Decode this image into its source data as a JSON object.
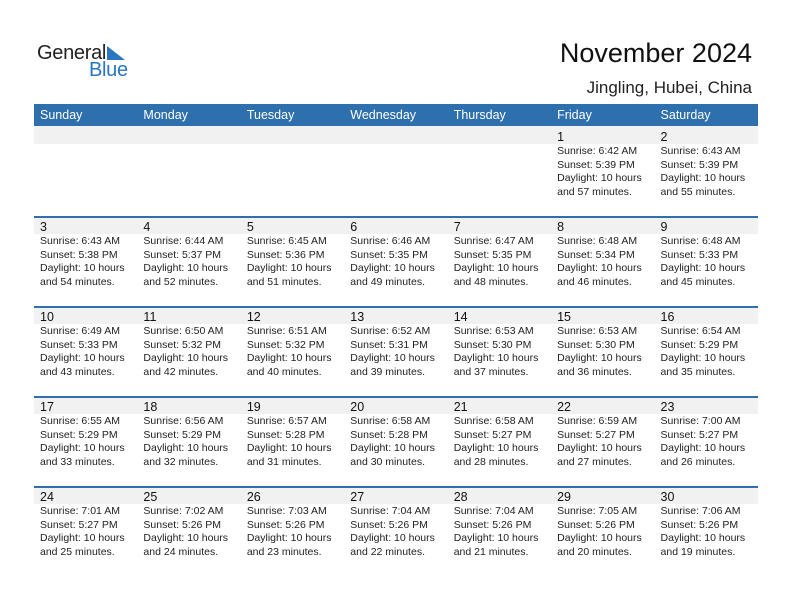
{
  "logo": {
    "line1": "General",
    "line2": "Blue"
  },
  "title": "November 2024",
  "location": "Jingling, Hubei, China",
  "colors": {
    "accent": "#2e6fad",
    "logo_blue": "#2a77c0",
    "band": "#f1f1f1"
  },
  "weekdays": [
    "Sunday",
    "Monday",
    "Tuesday",
    "Wednesday",
    "Thursday",
    "Friday",
    "Saturday"
  ],
  "weeks": [
    [
      {
        "day": "",
        "sunrise": "",
        "sunset": "",
        "daylight1": "",
        "daylight2": ""
      },
      {
        "day": "",
        "sunrise": "",
        "sunset": "",
        "daylight1": "",
        "daylight2": ""
      },
      {
        "day": "",
        "sunrise": "",
        "sunset": "",
        "daylight1": "",
        "daylight2": ""
      },
      {
        "day": "",
        "sunrise": "",
        "sunset": "",
        "daylight1": "",
        "daylight2": ""
      },
      {
        "day": "",
        "sunrise": "",
        "sunset": "",
        "daylight1": "",
        "daylight2": ""
      },
      {
        "day": "1",
        "sunrise": "Sunrise: 6:42 AM",
        "sunset": "Sunset: 5:39 PM",
        "daylight1": "Daylight: 10 hours",
        "daylight2": "and 57 minutes."
      },
      {
        "day": "2",
        "sunrise": "Sunrise: 6:43 AM",
        "sunset": "Sunset: 5:39 PM",
        "daylight1": "Daylight: 10 hours",
        "daylight2": "and 55 minutes."
      }
    ],
    [
      {
        "day": "3",
        "sunrise": "Sunrise: 6:43 AM",
        "sunset": "Sunset: 5:38 PM",
        "daylight1": "Daylight: 10 hours",
        "daylight2": "and 54 minutes."
      },
      {
        "day": "4",
        "sunrise": "Sunrise: 6:44 AM",
        "sunset": "Sunset: 5:37 PM",
        "daylight1": "Daylight: 10 hours",
        "daylight2": "and 52 minutes."
      },
      {
        "day": "5",
        "sunrise": "Sunrise: 6:45 AM",
        "sunset": "Sunset: 5:36 PM",
        "daylight1": "Daylight: 10 hours",
        "daylight2": "and 51 minutes."
      },
      {
        "day": "6",
        "sunrise": "Sunrise: 6:46 AM",
        "sunset": "Sunset: 5:35 PM",
        "daylight1": "Daylight: 10 hours",
        "daylight2": "and 49 minutes."
      },
      {
        "day": "7",
        "sunrise": "Sunrise: 6:47 AM",
        "sunset": "Sunset: 5:35 PM",
        "daylight1": "Daylight: 10 hours",
        "daylight2": "and 48 minutes."
      },
      {
        "day": "8",
        "sunrise": "Sunrise: 6:48 AM",
        "sunset": "Sunset: 5:34 PM",
        "daylight1": "Daylight: 10 hours",
        "daylight2": "and 46 minutes."
      },
      {
        "day": "9",
        "sunrise": "Sunrise: 6:48 AM",
        "sunset": "Sunset: 5:33 PM",
        "daylight1": "Daylight: 10 hours",
        "daylight2": "and 45 minutes."
      }
    ],
    [
      {
        "day": "10",
        "sunrise": "Sunrise: 6:49 AM",
        "sunset": "Sunset: 5:33 PM",
        "daylight1": "Daylight: 10 hours",
        "daylight2": "and 43 minutes."
      },
      {
        "day": "11",
        "sunrise": "Sunrise: 6:50 AM",
        "sunset": "Sunset: 5:32 PM",
        "daylight1": "Daylight: 10 hours",
        "daylight2": "and 42 minutes."
      },
      {
        "day": "12",
        "sunrise": "Sunrise: 6:51 AM",
        "sunset": "Sunset: 5:32 PM",
        "daylight1": "Daylight: 10 hours",
        "daylight2": "and 40 minutes."
      },
      {
        "day": "13",
        "sunrise": "Sunrise: 6:52 AM",
        "sunset": "Sunset: 5:31 PM",
        "daylight1": "Daylight: 10 hours",
        "daylight2": "and 39 minutes."
      },
      {
        "day": "14",
        "sunrise": "Sunrise: 6:53 AM",
        "sunset": "Sunset: 5:30 PM",
        "daylight1": "Daylight: 10 hours",
        "daylight2": "and 37 minutes."
      },
      {
        "day": "15",
        "sunrise": "Sunrise: 6:53 AM",
        "sunset": "Sunset: 5:30 PM",
        "daylight1": "Daylight: 10 hours",
        "daylight2": "and 36 minutes."
      },
      {
        "day": "16",
        "sunrise": "Sunrise: 6:54 AM",
        "sunset": "Sunset: 5:29 PM",
        "daylight1": "Daylight: 10 hours",
        "daylight2": "and 35 minutes."
      }
    ],
    [
      {
        "day": "17",
        "sunrise": "Sunrise: 6:55 AM",
        "sunset": "Sunset: 5:29 PM",
        "daylight1": "Daylight: 10 hours",
        "daylight2": "and 33 minutes."
      },
      {
        "day": "18",
        "sunrise": "Sunrise: 6:56 AM",
        "sunset": "Sunset: 5:29 PM",
        "daylight1": "Daylight: 10 hours",
        "daylight2": "and 32 minutes."
      },
      {
        "day": "19",
        "sunrise": "Sunrise: 6:57 AM",
        "sunset": "Sunset: 5:28 PM",
        "daylight1": "Daylight: 10 hours",
        "daylight2": "and 31 minutes."
      },
      {
        "day": "20",
        "sunrise": "Sunrise: 6:58 AM",
        "sunset": "Sunset: 5:28 PM",
        "daylight1": "Daylight: 10 hours",
        "daylight2": "and 30 minutes."
      },
      {
        "day": "21",
        "sunrise": "Sunrise: 6:58 AM",
        "sunset": "Sunset: 5:27 PM",
        "daylight1": "Daylight: 10 hours",
        "daylight2": "and 28 minutes."
      },
      {
        "day": "22",
        "sunrise": "Sunrise: 6:59 AM",
        "sunset": "Sunset: 5:27 PM",
        "daylight1": "Daylight: 10 hours",
        "daylight2": "and 27 minutes."
      },
      {
        "day": "23",
        "sunrise": "Sunrise: 7:00 AM",
        "sunset": "Sunset: 5:27 PM",
        "daylight1": "Daylight: 10 hours",
        "daylight2": "and 26 minutes."
      }
    ],
    [
      {
        "day": "24",
        "sunrise": "Sunrise: 7:01 AM",
        "sunset": "Sunset: 5:27 PM",
        "daylight1": "Daylight: 10 hours",
        "daylight2": "and 25 minutes."
      },
      {
        "day": "25",
        "sunrise": "Sunrise: 7:02 AM",
        "sunset": "Sunset: 5:26 PM",
        "daylight1": "Daylight: 10 hours",
        "daylight2": "and 24 minutes."
      },
      {
        "day": "26",
        "sunrise": "Sunrise: 7:03 AM",
        "sunset": "Sunset: 5:26 PM",
        "daylight1": "Daylight: 10 hours",
        "daylight2": "and 23 minutes."
      },
      {
        "day": "27",
        "sunrise": "Sunrise: 7:04 AM",
        "sunset": "Sunset: 5:26 PM",
        "daylight1": "Daylight: 10 hours",
        "daylight2": "and 22 minutes."
      },
      {
        "day": "28",
        "sunrise": "Sunrise: 7:04 AM",
        "sunset": "Sunset: 5:26 PM",
        "daylight1": "Daylight: 10 hours",
        "daylight2": "and 21 minutes."
      },
      {
        "day": "29",
        "sunrise": "Sunrise: 7:05 AM",
        "sunset": "Sunset: 5:26 PM",
        "daylight1": "Daylight: 10 hours",
        "daylight2": "and 20 minutes."
      },
      {
        "day": "30",
        "sunrise": "Sunrise: 7:06 AM",
        "sunset": "Sunset: 5:26 PM",
        "daylight1": "Daylight: 10 hours",
        "daylight2": "and 19 minutes."
      }
    ]
  ]
}
